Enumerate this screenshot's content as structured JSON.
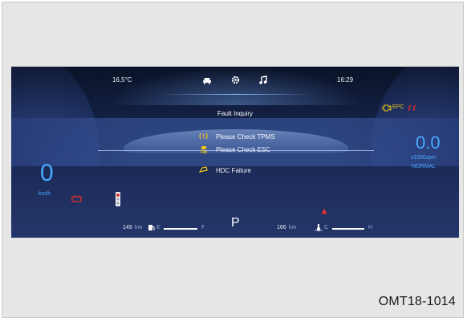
{
  "cluster": {
    "outside_temp": "16,5°C",
    "time": "16:29",
    "top_icons": [
      "car-icon",
      "gear-icon",
      "music-icon"
    ],
    "fault_title": "Fault Inquiry",
    "messages": [
      {
        "text": "Please Check TPMS",
        "icon": "tpms-warning-icon"
      },
      {
        "text": "Please Check ESC",
        "icon": "esc-warning-icon"
      },
      {
        "text": "HDC Failure",
        "icon": "hdc-icon"
      }
    ],
    "speed": {
      "value": "0",
      "unit": "km/h"
    },
    "rpm": {
      "value": "0.0",
      "unit": "x1000rpm",
      "mode": "NORMAL"
    },
    "epc_label": "EPC",
    "fuel": {
      "range": "149",
      "range_unit": "km",
      "empty_label": "E",
      "full_label": "F"
    },
    "gear": "P",
    "coolant": {
      "range": "166",
      "range_unit": "km",
      "cold_label": "C",
      "hot_label": "H"
    },
    "colors": {
      "amber": "#f0c419",
      "red": "#e0322b",
      "blue": "#4aa8ff"
    }
  },
  "figure_code": "OMT18-1014"
}
